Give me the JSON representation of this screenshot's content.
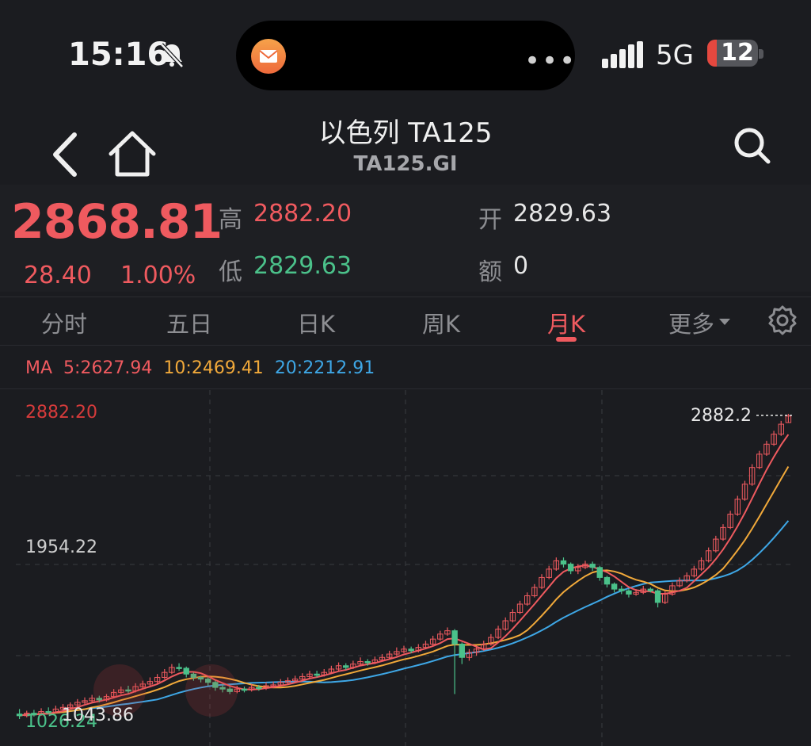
{
  "status_bar": {
    "time": "15:16",
    "network": "5G",
    "battery": "12",
    "icons": [
      "bell-slash-icon",
      "mail-icon",
      "more-dots-icon",
      "signal-icon",
      "battery-icon"
    ]
  },
  "header": {
    "title": "以色列 TA125",
    "subtitle": "TA125.GI",
    "icons": [
      "back-icon",
      "home-icon",
      "search-icon"
    ]
  },
  "quote": {
    "price": "2868.81",
    "change": "28.40",
    "change_pct": "1.00%",
    "high_label": "高",
    "high": "2882.20",
    "low_label": "低",
    "low": "2829.63",
    "open_label": "开",
    "open": "2829.63",
    "amount_label": "额",
    "amount": "0"
  },
  "tabs": [
    {
      "label": "分时"
    },
    {
      "label": "五日"
    },
    {
      "label": "日K"
    },
    {
      "label": "周K"
    },
    {
      "label": "月K",
      "active": true
    },
    {
      "label": "更多"
    }
  ],
  "ma": {
    "label": "MA",
    "ma5": "5:2627.94",
    "ma10": "10:2469.41",
    "ma20": "20:2212.91"
  },
  "colors": {
    "up": "#ef5a5f",
    "down": "#4bc18a",
    "ma5": "#ef5a5f",
    "ma10": "#f1a93a",
    "ma20": "#3ea7e6",
    "background": "#1b1c20"
  },
  "chart_data": {
    "type": "candlestick",
    "y_labels": {
      "top": "2882.20",
      "mid": "1954.22",
      "bottom": "1026.24"
    },
    "max_marker": "2882.2",
    "min_marker": "1043.86",
    "ylim": [
      1026.24,
      2882.2
    ],
    "grid": true,
    "candles": [
      [
        1080,
        1070,
        1110,
        1050
      ],
      [
        1070,
        1085,
        1100,
        1060
      ],
      [
        1085,
        1075,
        1105,
        1065
      ],
      [
        1075,
        1095,
        1115,
        1070
      ],
      [
        1095,
        1090,
        1120,
        1080
      ],
      [
        1090,
        1110,
        1130,
        1085
      ],
      [
        1110,
        1120,
        1140,
        1100
      ],
      [
        1120,
        1135,
        1150,
        1110
      ],
      [
        1135,
        1150,
        1170,
        1125
      ],
      [
        1150,
        1160,
        1180,
        1140
      ],
      [
        1160,
        1175,
        1195,
        1150
      ],
      [
        1175,
        1165,
        1190,
        1150
      ],
      [
        1165,
        1185,
        1200,
        1155
      ],
      [
        1185,
        1210,
        1230,
        1175
      ],
      [
        1210,
        1225,
        1245,
        1200
      ],
      [
        1225,
        1220,
        1250,
        1205
      ],
      [
        1220,
        1245,
        1265,
        1210
      ],
      [
        1245,
        1260,
        1280,
        1235
      ],
      [
        1260,
        1275,
        1300,
        1250
      ],
      [
        1275,
        1300,
        1320,
        1265
      ],
      [
        1300,
        1330,
        1350,
        1290
      ],
      [
        1330,
        1360,
        1380,
        1320
      ],
      [
        1360,
        1355,
        1385,
        1340
      ],
      [
        1355,
        1320,
        1365,
        1300
      ],
      [
        1320,
        1300,
        1330,
        1280
      ],
      [
        1300,
        1290,
        1310,
        1270
      ],
      [
        1290,
        1270,
        1300,
        1250
      ],
      [
        1270,
        1240,
        1280,
        1220
      ],
      [
        1240,
        1230,
        1260,
        1210
      ],
      [
        1230,
        1215,
        1245,
        1200
      ],
      [
        1215,
        1230,
        1250,
        1205
      ],
      [
        1230,
        1225,
        1245,
        1210
      ],
      [
        1225,
        1240,
        1260,
        1215
      ],
      [
        1240,
        1235,
        1255,
        1220
      ],
      [
        1235,
        1250,
        1270,
        1225
      ],
      [
        1250,
        1255,
        1275,
        1240
      ],
      [
        1255,
        1270,
        1290,
        1245
      ],
      [
        1270,
        1280,
        1300,
        1260
      ],
      [
        1280,
        1290,
        1310,
        1270
      ],
      [
        1290,
        1305,
        1325,
        1280
      ],
      [
        1305,
        1320,
        1340,
        1295
      ],
      [
        1320,
        1315,
        1340,
        1300
      ],
      [
        1315,
        1330,
        1350,
        1305
      ],
      [
        1330,
        1350,
        1370,
        1320
      ],
      [
        1350,
        1370,
        1390,
        1340
      ],
      [
        1370,
        1360,
        1385,
        1345
      ],
      [
        1360,
        1380,
        1400,
        1350
      ],
      [
        1380,
        1395,
        1420,
        1370
      ],
      [
        1395,
        1390,
        1410,
        1370
      ],
      [
        1390,
        1405,
        1425,
        1380
      ],
      [
        1405,
        1420,
        1440,
        1395
      ],
      [
        1420,
        1440,
        1460,
        1410
      ],
      [
        1440,
        1455,
        1480,
        1430
      ],
      [
        1455,
        1470,
        1490,
        1445
      ],
      [
        1470,
        1460,
        1485,
        1445
      ],
      [
        1460,
        1480,
        1500,
        1450
      ],
      [
        1480,
        1500,
        1520,
        1470
      ],
      [
        1500,
        1530,
        1550,
        1490
      ],
      [
        1530,
        1560,
        1580,
        1520
      ],
      [
        1560,
        1580,
        1600,
        1550
      ],
      [
        1580,
        1500,
        1590,
        1200
      ],
      [
        1500,
        1420,
        1510,
        1380
      ],
      [
        1420,
        1450,
        1470,
        1400
      ],
      [
        1450,
        1470,
        1490,
        1430
      ],
      [
        1470,
        1500,
        1520,
        1460
      ],
      [
        1500,
        1540,
        1560,
        1490
      ],
      [
        1540,
        1590,
        1610,
        1530
      ],
      [
        1590,
        1640,
        1660,
        1580
      ],
      [
        1640,
        1690,
        1710,
        1630
      ],
      [
        1690,
        1740,
        1760,
        1680
      ],
      [
        1740,
        1790,
        1810,
        1730
      ],
      [
        1790,
        1840,
        1860,
        1780
      ],
      [
        1840,
        1900,
        1920,
        1830
      ],
      [
        1900,
        1950,
        1970,
        1890
      ],
      [
        1950,
        2000,
        2020,
        1940
      ],
      [
        2000,
        1980,
        2020,
        1960
      ],
      [
        1980,
        1940,
        1990,
        1920
      ],
      [
        1940,
        1960,
        1980,
        1920
      ],
      [
        1960,
        1980,
        2000,
        1950
      ],
      [
        1980,
        1960,
        1995,
        1940
      ],
      [
        1960,
        1900,
        1970,
        1880
      ],
      [
        1900,
        1860,
        1910,
        1840
      ],
      [
        1860,
        1830,
        1870,
        1810
      ],
      [
        1830,
        1820,
        1850,
        1800
      ],
      [
        1820,
        1800,
        1830,
        1780
      ],
      [
        1800,
        1810,
        1830,
        1790
      ],
      [
        1810,
        1830,
        1850,
        1800
      ],
      [
        1830,
        1820,
        1840,
        1810
      ],
      [
        1820,
        1750,
        1830,
        1720
      ],
      [
        1750,
        1800,
        1820,
        1740
      ],
      [
        1800,
        1850,
        1870,
        1790
      ],
      [
        1850,
        1880,
        1900,
        1840
      ],
      [
        1880,
        1910,
        1930,
        1870
      ],
      [
        1910,
        1950,
        1970,
        1900
      ],
      [
        1950,
        2000,
        2020,
        1940
      ],
      [
        2000,
        2060,
        2080,
        1990
      ],
      [
        2060,
        2130,
        2150,
        2050
      ],
      [
        2130,
        2200,
        2220,
        2120
      ],
      [
        2200,
        2280,
        2300,
        2190
      ],
      [
        2280,
        2370,
        2390,
        2270
      ],
      [
        2370,
        2460,
        2480,
        2360
      ],
      [
        2460,
        2560,
        2580,
        2450
      ],
      [
        2560,
        2640,
        2660,
        2550
      ],
      [
        2640,
        2700,
        2720,
        2630
      ],
      [
        2700,
        2760,
        2780,
        2690
      ],
      [
        2760,
        2820,
        2840,
        2750
      ],
      [
        2829.63,
        2868.81,
        2882.2,
        2829.63
      ]
    ]
  }
}
